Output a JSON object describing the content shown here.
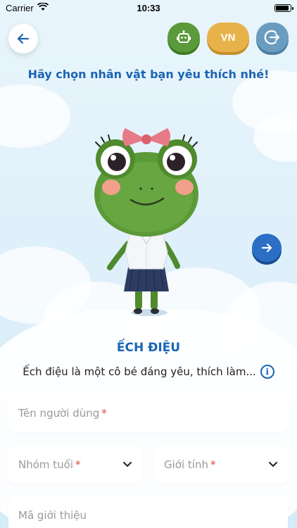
{
  "status_bar": {
    "carrier": "Carrier",
    "time": "10:33",
    "battery_level": 0.9
  },
  "header": {
    "lang_label": "VN"
  },
  "heading": "Hãy chọn nhân vật bạn yêu thích nhé!",
  "character": {
    "name": "ẾCH ĐIỆU",
    "description": "Ếch điệu là một cô bé đáng yêu, thích làm..."
  },
  "form": {
    "username_placeholder": "Tên người dùng",
    "age_group_placeholder": "Nhóm tuổi",
    "gender_placeholder": "Giới tính",
    "referral_placeholder": "Mã giới thiệu",
    "required_mark": "*"
  },
  "icons": {
    "back": "arrow-left-icon",
    "robot": "robot-icon",
    "logout": "logout-icon",
    "next": "arrow-right-icon",
    "info": "info-icon",
    "dropdown": "chevron-down-icon"
  },
  "colors": {
    "primary": "#1a64b4",
    "robot_button": "#5a9a3a",
    "lang_button": "#e8b24a",
    "logout_button": "#6a9cbf",
    "required": "#e0443c"
  }
}
